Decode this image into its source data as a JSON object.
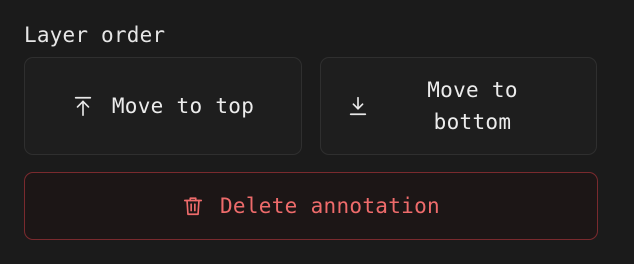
{
  "section": {
    "title": "Layer order"
  },
  "buttons": {
    "move_to_top": {
      "label": "Move to top",
      "icon": "arrow-up-to-line-icon"
    },
    "move_to_bottom": {
      "label": "Move to\nbottom",
      "icon": "arrow-down-to-line-icon"
    },
    "delete": {
      "label": "Delete annotation",
      "icon": "trash-icon"
    }
  },
  "colors": {
    "background": "#1b1b1b",
    "button_border": "#2f2f2f",
    "danger_text": "#ee6b6b",
    "danger_border": "#7a2a2e"
  }
}
